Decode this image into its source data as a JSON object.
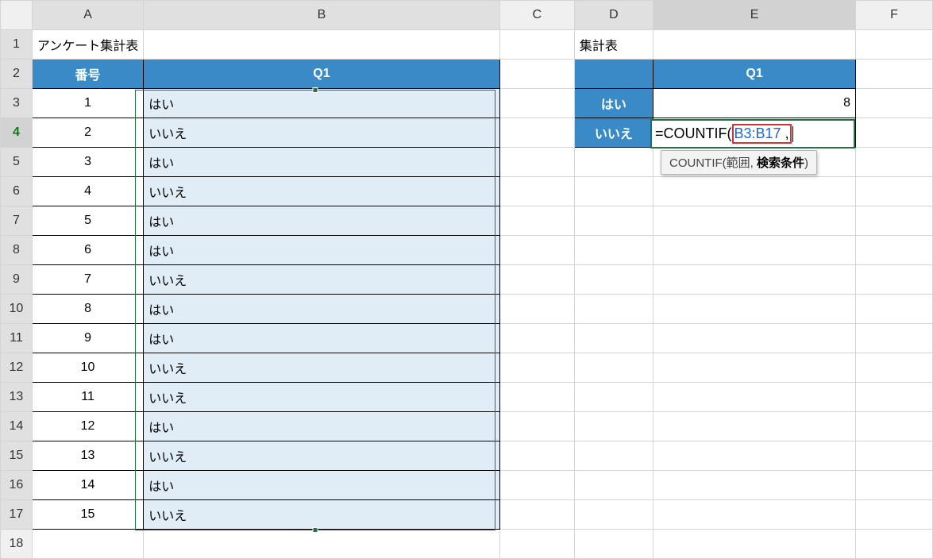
{
  "columns": [
    "A",
    "B",
    "C",
    "D",
    "E",
    "F"
  ],
  "row_count": 18,
  "active_row": 4,
  "active_col": "E",
  "titles": {
    "survey_title": "アンケート集計表",
    "summary_title": "集計表"
  },
  "survey": {
    "header_number": "番号",
    "header_q1": "Q1",
    "rows": [
      {
        "num": "1",
        "ans": "はい"
      },
      {
        "num": "2",
        "ans": "いいえ"
      },
      {
        "num": "3",
        "ans": "はい"
      },
      {
        "num": "4",
        "ans": "いいえ"
      },
      {
        "num": "5",
        "ans": "はい"
      },
      {
        "num": "6",
        "ans": "はい"
      },
      {
        "num": "7",
        "ans": "いいえ"
      },
      {
        "num": "8",
        "ans": "はい"
      },
      {
        "num": "9",
        "ans": "はい"
      },
      {
        "num": "10",
        "ans": "いいえ"
      },
      {
        "num": "11",
        "ans": "いいえ"
      },
      {
        "num": "12",
        "ans": "はい"
      },
      {
        "num": "13",
        "ans": "いいえ"
      },
      {
        "num": "14",
        "ans": "はい"
      },
      {
        "num": "15",
        "ans": "いいえ"
      }
    ]
  },
  "summary": {
    "header_q1": "Q1",
    "rows": [
      {
        "label": "はい",
        "value": "8"
      },
      {
        "label": "いいえ",
        "value": ""
      }
    ]
  },
  "formula": {
    "prefix": "=COUNTIF(",
    "arg1": "B3:B17",
    "after_arg1": ",",
    "tooltip_fn": "COUNTIF(",
    "tooltip_arg1": "範囲",
    "tooltip_sep": ", ",
    "tooltip_arg2": "検索条件",
    "tooltip_close": ")"
  }
}
